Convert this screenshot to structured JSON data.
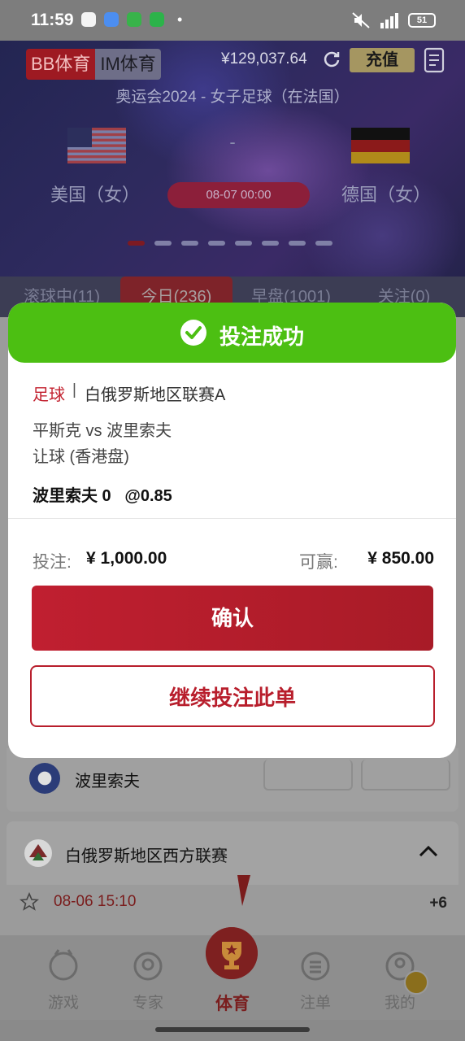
{
  "status_bar": {
    "time": "11:59",
    "dot": "•",
    "network": "4G",
    "battery": "51"
  },
  "banner": {
    "providers": [
      "BB体育",
      "IM体育"
    ],
    "active_provider": "BB体育",
    "balance": "¥129,037.64",
    "recharge_label": "充值",
    "event_title": "奥运会2024 - 女子足球（在法国）",
    "home_team": "美国（女）",
    "away_team": "德国（女）",
    "vs_separator": "-",
    "match_time": "08-07  00:00",
    "pager_total": 8,
    "pager_active": 0
  },
  "category_tabs": [
    {
      "label": "滚球中(11)",
      "active": false
    },
    {
      "label": "今日(236)",
      "active": true
    },
    {
      "label": "早盘(1001)",
      "active": false
    },
    {
      "label": "关注(0)",
      "active": false
    }
  ],
  "list": {
    "match_card_team": "波里索夫",
    "league_name": "白俄罗斯地区西方联赛",
    "match_time": "08-06 15:10",
    "more_count": "+6"
  },
  "modal": {
    "title": "投注成功",
    "sport": "足球",
    "separator": "|",
    "league": "白俄罗斯地区联赛A",
    "match": "平斯克 vs 波里索夫",
    "market": "让球 (香港盘)",
    "selection": "波里索夫 0   @0.85",
    "stake_label": "投注:",
    "stake_value": "¥ 1,000.00",
    "win_label": "可赢:",
    "win_value": "¥ 850.00",
    "confirm_label": "确认",
    "continue_label": "继续投注此单"
  },
  "bottom_nav": [
    {
      "label": "游戏",
      "icon": "game-icon",
      "active": false
    },
    {
      "label": "专家",
      "icon": "expert-icon",
      "active": false
    },
    {
      "label": "体育",
      "icon": "sports-trophy-icon",
      "active": true
    },
    {
      "label": "注单",
      "icon": "bet-slip-icon",
      "active": false
    },
    {
      "label": "我的",
      "icon": "profile-icon",
      "active": false
    }
  ],
  "colors": {
    "success_green": "#4cbf12",
    "brand_red": "#c01f30",
    "sport_red": "#c21f2d"
  }
}
